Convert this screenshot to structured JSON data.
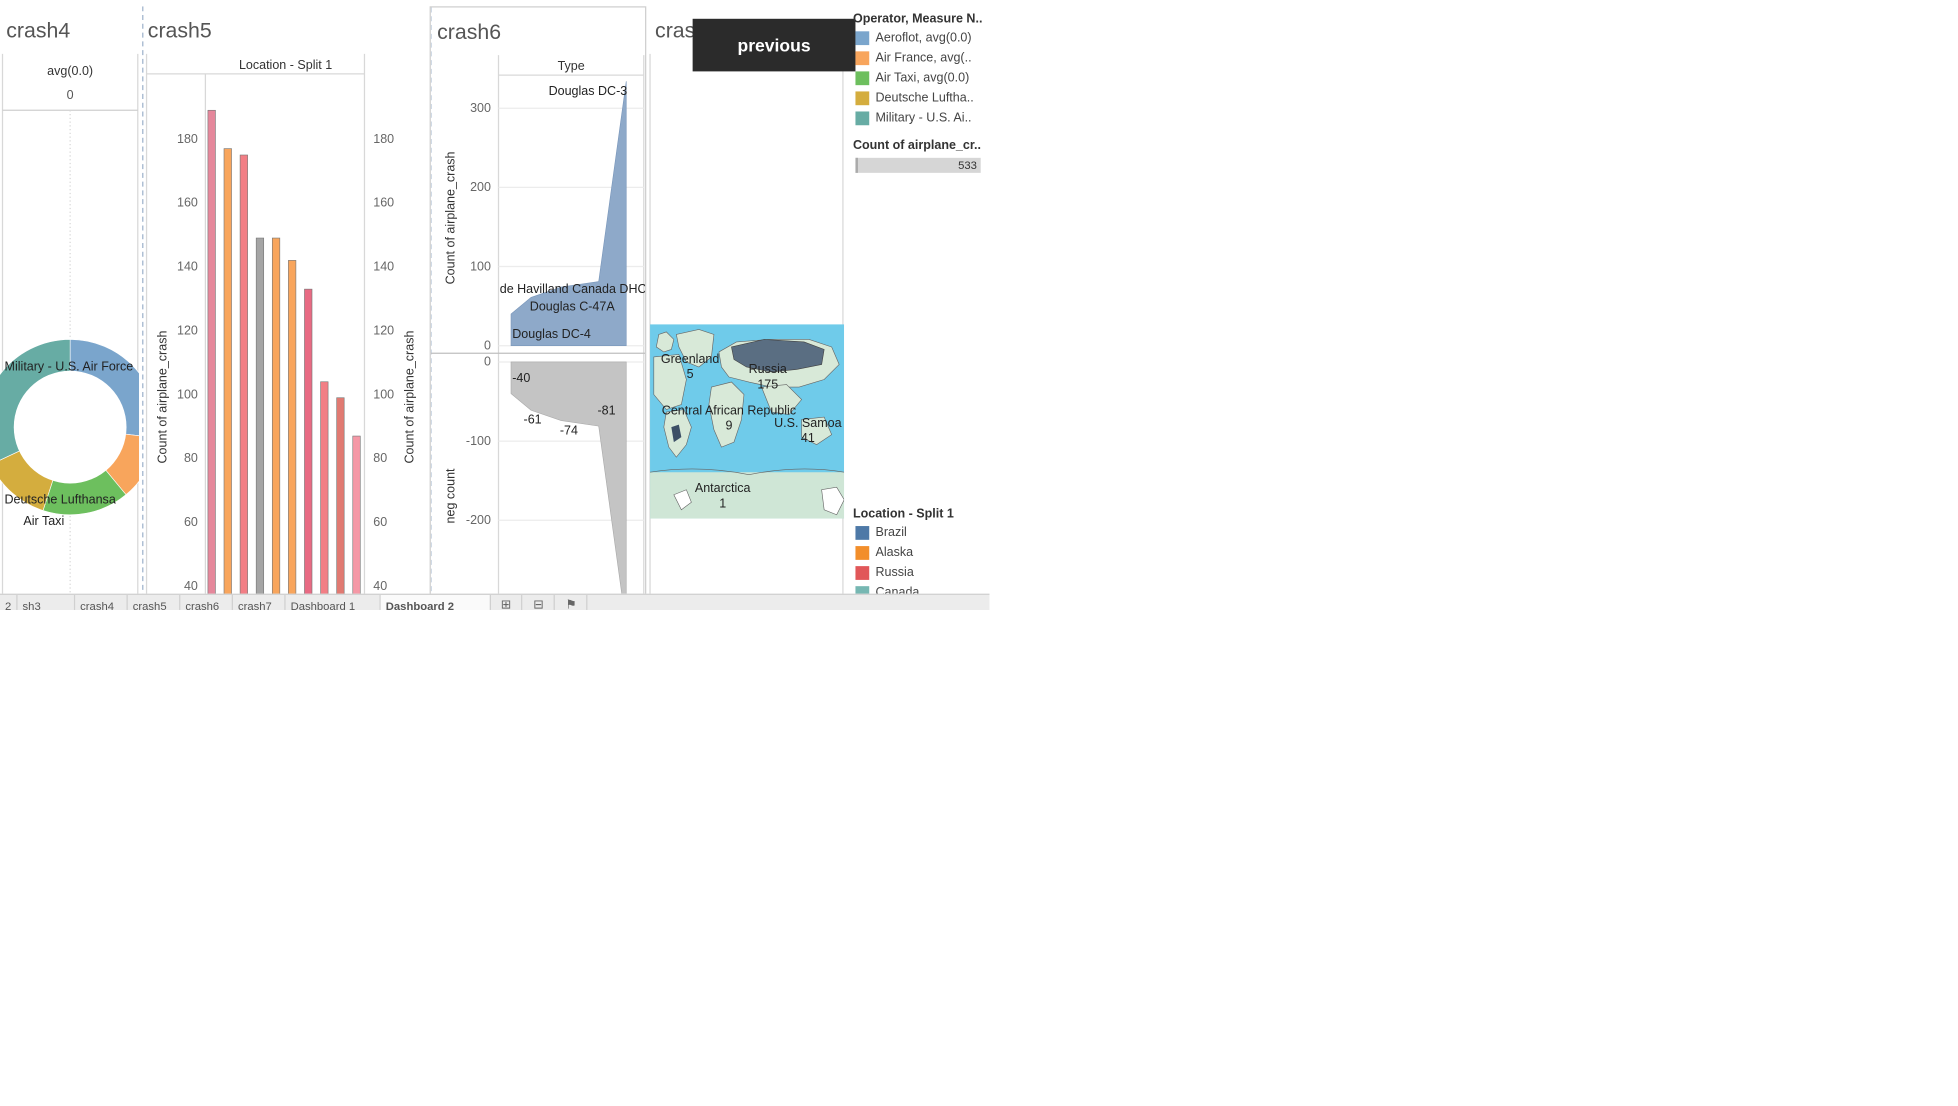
{
  "sheets": {
    "crash4": {
      "title": "crash4",
      "header": "avg(0.0)",
      "header_value": "0",
      "labels": {
        "military": "Military - U.S. Air Force",
        "lufthansa": "Deutsche Lufthansa",
        "airtaxi": "Air Taxi"
      }
    },
    "crash5": {
      "title": "crash5",
      "header": "Location - Split 1",
      "ylabel_left": "Count of airplane_crash",
      "ylabel_right": "Count of airplane_crash"
    },
    "crash6": {
      "title": "crash6",
      "header": "Type",
      "ylabel_top": "Count of airplane_crash",
      "ylabel_bottom": "neg count"
    },
    "crash7": {
      "title": "cras"
    }
  },
  "previous_button": "previous",
  "legends": {
    "operator": {
      "title": "Operator, Measure N..",
      "items": [
        {
          "label": "Aeroflot, avg(0.0)",
          "color": "#7aa5cc"
        },
        {
          "label": "Air France, avg(..",
          "color": "#f8a55c"
        },
        {
          "label": "Air Taxi, avg(0.0)",
          "color": "#6dbf5e"
        },
        {
          "label": "Deutsche Luftha..",
          "color": "#d4ad3e"
        },
        {
          "label": "Military - U.S. Ai..",
          "color": "#67aca4"
        }
      ]
    },
    "count": {
      "title": "Count of airplane_cr..",
      "value": "533"
    },
    "location": {
      "title": "Location - Split 1",
      "items": [
        {
          "label": "Brazil",
          "color": "#4e79a7"
        },
        {
          "label": "Alaska",
          "color": "#f28e2b"
        },
        {
          "label": "Russia",
          "color": "#e15759"
        },
        {
          "label": "Canada",
          "color": "#76b7b2"
        }
      ]
    }
  },
  "map": {
    "labels": [
      {
        "text": "Greenland",
        "value": "5"
      },
      {
        "text": "Russia",
        "value": "175"
      },
      {
        "text": "Central African Republic",
        "value": "9"
      },
      {
        "text": "U.S. Samoa",
        "value": "41"
      },
      {
        "text": "Antarctica",
        "value": "1"
      }
    ]
  },
  "tabs": [
    {
      "label": "2"
    },
    {
      "label": "sh3"
    },
    {
      "label": "crash4"
    },
    {
      "label": "crash5"
    },
    {
      "label": "crash6"
    },
    {
      "label": "crash7"
    },
    {
      "label": "Dashboard 1"
    },
    {
      "label": "Dashboard 2",
      "active": true
    }
  ],
  "chart_data": [
    {
      "type": "pie",
      "title": "crash4",
      "categories": [
        "Aeroflot",
        "Air France",
        "Air Taxi",
        "Deutsche Lufthansa",
        "Military - U.S. Air Force"
      ],
      "values": [
        27,
        12,
        16,
        13,
        32
      ],
      "colors": [
        "#7aa5cc",
        "#f8a55c",
        "#6dbf5e",
        "#d4ad3e",
        "#67aca4"
      ]
    },
    {
      "type": "bar",
      "title": "crash5",
      "xlabel": "Location - Split 1",
      "ylabel": "Count of airplane_crash",
      "ylim": [
        40,
        190
      ],
      "yticks": [
        40,
        60,
        80,
        100,
        120,
        140,
        160,
        180
      ],
      "values": [
        189,
        177,
        175,
        149,
        149,
        142,
        133,
        104,
        99,
        87
      ],
      "colors": [
        "#e5879b",
        "#f8a55c",
        "#f27e85",
        "#a5a5a5",
        "#f8a55c",
        "#f8a55c",
        "#e86a83",
        "#f27e85",
        "#e17a72",
        "#f598a6"
      ]
    },
    {
      "type": "area",
      "title": "crash6",
      "xlabel": "Type",
      "ylabel": "Count of airplane_crash",
      "ylim": [
        -300,
        340
      ],
      "yticks_top": [
        0,
        100,
        200,
        300
      ],
      "yticks_bottom": [
        0,
        -100,
        -200,
        -300
      ],
      "series": [
        {
          "name": "Count of airplane_crash",
          "values": [
            40,
            61,
            74,
            81,
            334
          ],
          "labels": [
            "Douglas DC-4",
            "Douglas C-47A",
            "de Havilland Canada DHC-",
            "",
            "Douglas DC-3"
          ],
          "color": "#8ea9c9"
        },
        {
          "name": "neg count",
          "values": [
            -40,
            -61,
            -74,
            -81,
            -334
          ],
          "labels": [
            "-40",
            "-61",
            "-74",
            "-81",
            ""
          ],
          "color": "#c4c4c4"
        }
      ]
    }
  ]
}
